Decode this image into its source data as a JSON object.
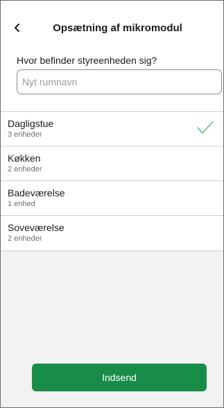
{
  "header": {
    "title": "Opsætning af mikromodul",
    "back_icon": "chevron-left-icon"
  },
  "form": {
    "question": "Hvor befinder styreenheden sig?",
    "room_input": {
      "value": "",
      "placeholder": "Nyt rumnavn"
    }
  },
  "rooms": [
    {
      "name": "Dagligstue",
      "devices": "3 enheder",
      "selected": true
    },
    {
      "name": "Køkken",
      "devices": "2 enheder",
      "selected": false
    },
    {
      "name": "Badeværelse",
      "devices": "1 enhed",
      "selected": false
    },
    {
      "name": "Soveværelse",
      "devices": "2 enheder",
      "selected": false
    }
  ],
  "submit": {
    "label": "Indsend"
  },
  "colors": {
    "accent": "#188d4a",
    "check": "#3dab5f",
    "list_background": "#f2f2f2"
  }
}
